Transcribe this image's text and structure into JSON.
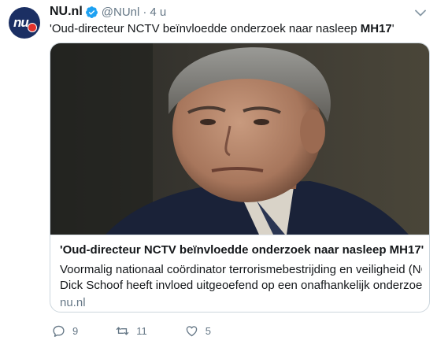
{
  "tweet": {
    "author_name": "NU.nl",
    "handle": "@NUnl",
    "separator": "·",
    "timestamp": "4 u",
    "text_plain": "'Oud-directeur NCTV beïnvloedde onderzoek naar nasleep ",
    "text_bold": "MH17",
    "text_end": "'",
    "avatar_icon": "nu-nl-logo",
    "verified_icon": "verified-badge-icon",
    "menu_icon": "chevron-down-icon"
  },
  "card": {
    "title": "'Oud-directeur NCTV beïnvloedde onderzoek naar nasleep MH17'",
    "description_line1": "Voormalig nationaal coördinator terrorismebestrijding en veiligheid (NCTV)",
    "description_line2": "Dick Schoof heeft invloed uitgeoefend op een onafhankelijk onderzoek na...",
    "domain": "nu.nl",
    "image": "photo-of-man-in-suit"
  },
  "actions": {
    "reply_count": "9",
    "retweet_count": "11",
    "like_count": "5",
    "reply_icon": "reply-icon",
    "retweet_icon": "retweet-icon",
    "like_icon": "heart-icon"
  },
  "colors": {
    "verified": "#1da1f2",
    "secondary_text": "#657786",
    "border": "#ccd6dd",
    "avatar_bg": "#1b2f63",
    "avatar_dot": "#e4322b"
  }
}
